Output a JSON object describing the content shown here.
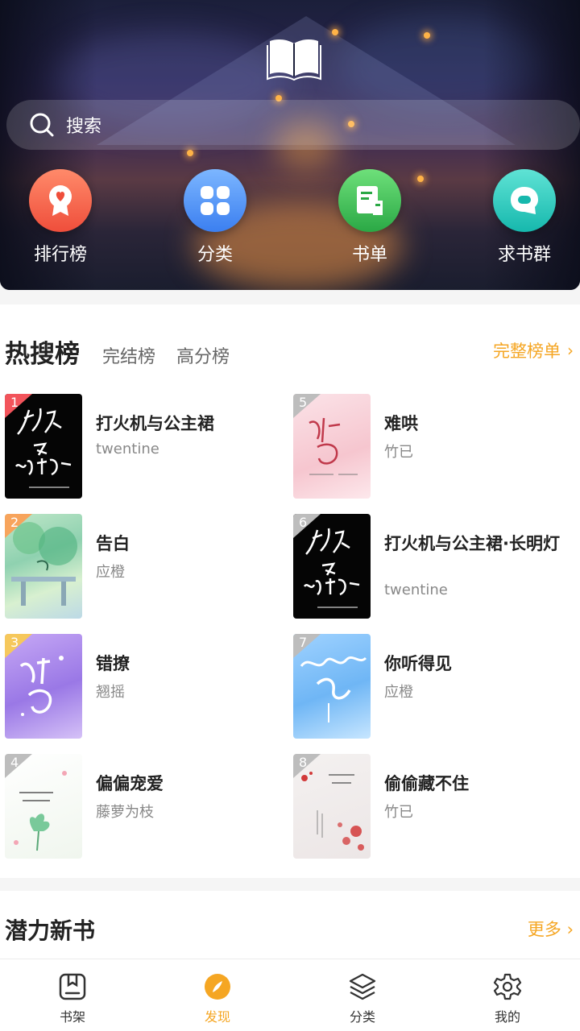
{
  "hero": {
    "search": {
      "placeholder": "搜索"
    },
    "quick_links": [
      {
        "label": "排行榜",
        "icon": "ranking-badge-icon",
        "color": "#ef4e3b"
      },
      {
        "label": "分类",
        "icon": "category-grid-icon",
        "color": "#3b7ff0"
      },
      {
        "label": "书单",
        "icon": "booklist-icon",
        "color": "#2aa845"
      },
      {
        "label": "求书群",
        "icon": "chat-bubble-icon",
        "color": "#16b8ad"
      }
    ]
  },
  "hot_list": {
    "tabs": [
      "热搜榜",
      "完结榜",
      "高分榜"
    ],
    "full_list_label": "完整榜单",
    "books": [
      {
        "rank": "1",
        "title": "打火机与公主裙",
        "author": "twentine"
      },
      {
        "rank": "2",
        "title": "告白",
        "author": "应橙"
      },
      {
        "rank": "3",
        "title": "错撩",
        "author": "翘摇"
      },
      {
        "rank": "4",
        "title": "偏偏宠爱",
        "author": "藤萝为枝"
      },
      {
        "rank": "5",
        "title": "难哄",
        "author": "竹已"
      },
      {
        "rank": "6",
        "title": "打火机与公主裙·长明灯",
        "author": "twentine"
      },
      {
        "rank": "7",
        "title": "你听得见",
        "author": "应橙"
      },
      {
        "rank": "8",
        "title": "偷偷藏不住",
        "author": "竹已"
      }
    ]
  },
  "potential": {
    "title": "潜力新书",
    "more_label": "更多"
  },
  "bottom_nav": [
    {
      "label": "书架",
      "icon": "bookshelf-icon",
      "active": false
    },
    {
      "label": "发现",
      "icon": "compass-icon",
      "active": true
    },
    {
      "label": "分类",
      "icon": "layers-icon",
      "active": false
    },
    {
      "label": "我的",
      "icon": "gear-icon",
      "active": false
    }
  ],
  "colors": {
    "accent": "#f5a623",
    "rank_top": "#f2545b"
  }
}
